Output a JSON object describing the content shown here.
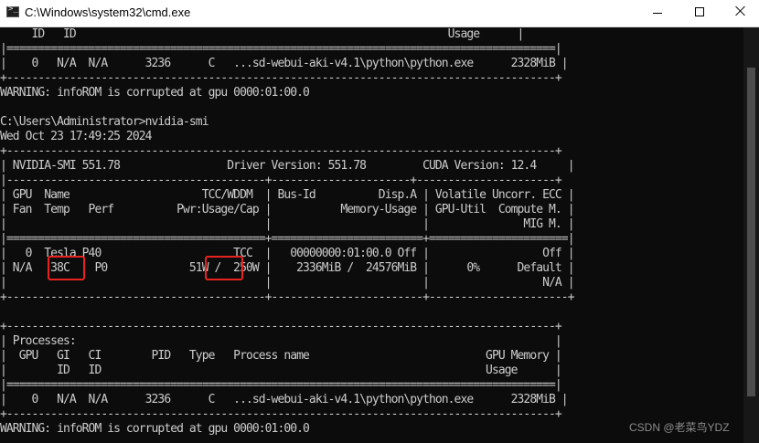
{
  "window": {
    "title": "C:\\Windows\\system32\\cmd.exe",
    "icon": "console-icon",
    "controls": {
      "minimize": "minimize-icon",
      "maximize": "maximize-icon",
      "close": "close-icon"
    }
  },
  "console": {
    "lines": [
      "     ID   ID                                                           Usage      |",
      "|=======================================================================================|",
      "|    0   N/A  N/A      3236      C   ...sd-webui-aki-v4.1\\python\\python.exe      2328MiB |",
      "+---------------------------------------------------------------------------------------+",
      "WARNING: infoROM is corrupted at gpu 0000:01:00.0",
      "",
      "C:\\Users\\Administrator>nvidia-smi",
      "Wed Oct 23 17:49:25 2024",
      "+---------------------------------------------------------------------------------------+",
      "| NVIDIA-SMI 551.78                 Driver Version: 551.78         CUDA Version: 12.4     |",
      "|-----------------------------------------+----------------------+----------------------+",
      "| GPU  Name                     TCC/WDDM  | Bus-Id          Disp.A | Volatile Uncorr. ECC |",
      "| Fan  Temp   Perf          Pwr:Usage/Cap |           Memory-Usage | GPU-Util  Compute M. |",
      "|                                         |                        |               MIG M. |",
      "|=========================================+========================+======================|",
      "|   0  Tesla P40                     TCC  |   00000000:01:00.0 Off |                  Off |",
      "| N/A   38C    P0             51W /  250W |    2336MiB /  24576MiB |      0%      Default |",
      "|                                         |                        |                  N/A |",
      "+-----------------------------------------+------------------------+----------------------+",
      "",
      "+---------------------------------------------------------------------------------------+",
      "| Processes:                                                                            |",
      "|  GPU   GI   CI        PID   Type   Process name                            GPU Memory |",
      "|        ID   ID                                                             Usage      |",
      "|=======================================================================================|",
      "|    0   N/A  N/A      3236      C   ...sd-webui-aki-v4.1\\python\\python.exe      2328MiB |",
      "+---------------------------------------------------------------------------------------+",
      "WARNING: infoROM is corrupted at gpu 0000:01:00.0"
    ]
  },
  "watermark": "CSDN @老菜鸟YDZ",
  "colors": {
    "console_bg": "#0c0c0c",
    "console_fg": "#cccccc",
    "highlight": "#e8231f",
    "titlebar_bg": "#ffffff"
  }
}
